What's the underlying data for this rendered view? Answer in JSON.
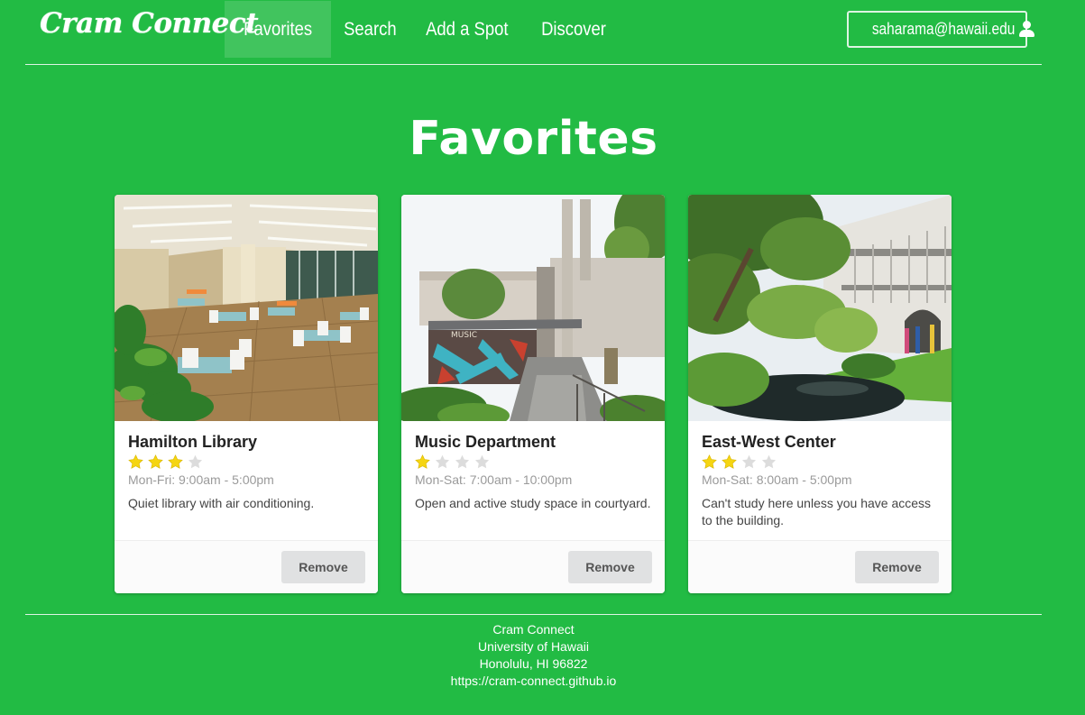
{
  "nav": {
    "brand": "Cram Connect",
    "links": [
      {
        "label": "Favorites",
        "active": true
      },
      {
        "label": "Search",
        "active": false
      },
      {
        "label": "Add a Spot",
        "active": false
      },
      {
        "label": "Discover",
        "active": false
      }
    ],
    "user_email": "saharama@hawaii.edu",
    "user_icon": "user-icon"
  },
  "page_title": "Favorites",
  "cards": [
    {
      "name": "Hamilton Library",
      "rating": 3,
      "max_rating": 4,
      "hours": "Mon-Fri: 9:00am - 5:00pm",
      "description": "Quiet library with air conditioning.",
      "remove_label": "Remove"
    },
    {
      "name": "Music Department",
      "rating": 1,
      "max_rating": 4,
      "hours": "Mon-Sat: 7:00am - 10:00pm",
      "description": "Open and active study space in courtyard.",
      "remove_label": "Remove"
    },
    {
      "name": "East-West Center",
      "rating": 2,
      "max_rating": 4,
      "hours": "Mon-Sat: 8:00am - 5:00pm",
      "description": "Can't study here unless you have access to the building.",
      "remove_label": "Remove"
    }
  ],
  "footer": {
    "line1": "Cram Connect",
    "line2": "University of Hawaii",
    "line3": "Honolulu, HI 96822",
    "line4": "https://cram-connect.github.io"
  },
  "colors": {
    "background": "#22bb44",
    "star_filled": "#f5d512",
    "star_empty": "#dcdcdc",
    "button_bg": "#e0e1e2"
  }
}
